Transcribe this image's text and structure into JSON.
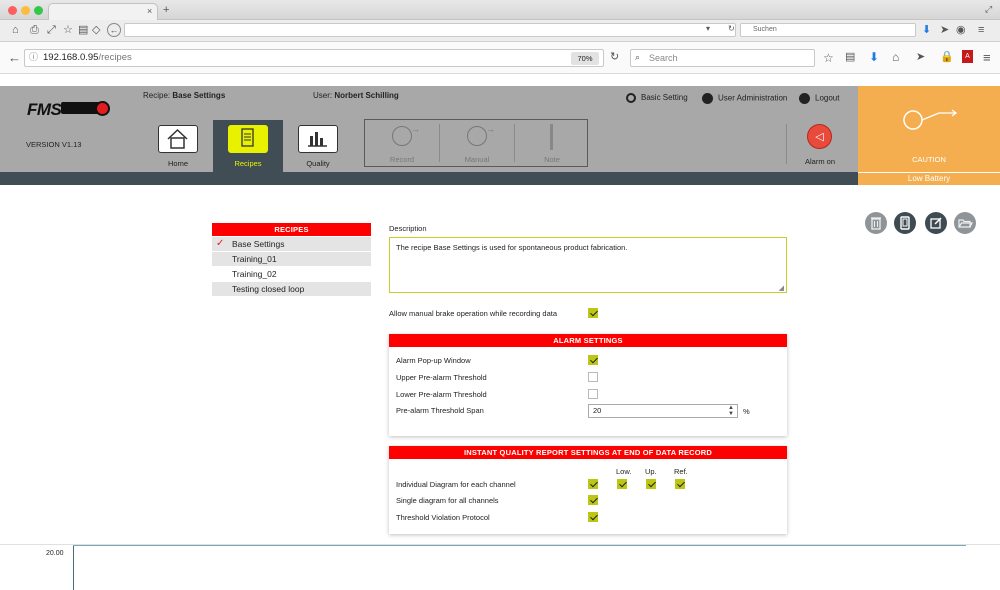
{
  "browser": {
    "search_top_placeholder": "Suchen",
    "url_host": "192.168.0.95",
    "url_path": "/recipes",
    "zoom": "70%",
    "search_placeholder": "Search"
  },
  "header": {
    "logo": "FMS",
    "version": "VERSION V1.13",
    "recipe_label": "Recipe:",
    "recipe_value": "Base Settings",
    "user_label": "User:",
    "user_value": "Norbert Schilling",
    "basic_setting": "Basic Setting",
    "user_admin": "User Administration",
    "logout": "Logout",
    "nav": [
      {
        "label": "Home",
        "icon": "home-icon"
      },
      {
        "label": "Recipes",
        "icon": "recipes-icon"
      },
      {
        "label": "Quality",
        "icon": "quality-chart-icon"
      }
    ],
    "record_group": [
      {
        "label": "Record",
        "icon": "record-icon"
      },
      {
        "label": "Manual",
        "icon": "manual-icon"
      },
      {
        "label": "Note",
        "icon": "note-icon"
      }
    ],
    "alarm_label": "Alarm on",
    "caution_label": "CAUTION",
    "battery_label": "Low Battery",
    "colors": {
      "header_gray": "#a8a8a8",
      "dark_bar": "#414d55",
      "caution": "#f4ad4f",
      "accent_red": "#ff0000",
      "check_green": "#bcc715",
      "active_yellow": "#e7f100"
    }
  },
  "recipes": {
    "title": "RECIPES",
    "items": [
      "Base Settings",
      "Training_01",
      "Training_02",
      "Testing closed loop"
    ],
    "selected_index": 0
  },
  "description": {
    "label": "Description",
    "text": "The recipe Base Settings is used for spontaneous product fabrication."
  },
  "manual_brake": {
    "label": "Allow manual brake operation while recording data",
    "checked": true
  },
  "alarm_settings": {
    "title": "ALARM SETTINGS",
    "rows": [
      {
        "label": "Alarm Pop-up Window",
        "checked": true
      },
      {
        "label": "Upper Pre-alarm Threshold",
        "checked": false
      },
      {
        "label": "Lower Pre-alarm Threshold",
        "checked": false
      }
    ],
    "span_label": "Pre-alarm Threshold Span",
    "span_value": "20",
    "span_unit": "%"
  },
  "quality_report": {
    "title": "INSTANT QUALITY REPORT SETTINGS AT END OF DATA RECORD",
    "col_low": "Low.",
    "col_up": "Up.",
    "col_ref": "Ref.",
    "rows": [
      {
        "label": "Individual Diagram for each channel",
        "checked": true
      },
      {
        "label": "Single diagram for all channels",
        "checked": true
      },
      {
        "label": "Threshold Violation Protocol",
        "checked": true
      }
    ]
  },
  "bottom": {
    "axis_label": "20.00"
  }
}
